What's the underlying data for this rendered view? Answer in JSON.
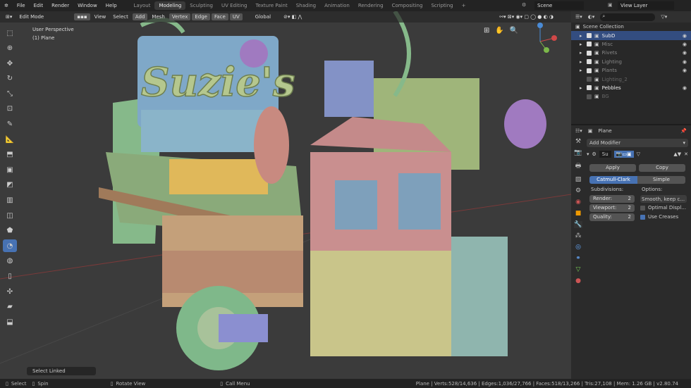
{
  "menu": [
    "File",
    "Edit",
    "Render",
    "Window",
    "Help"
  ],
  "workspaces": [
    {
      "label": "Layout"
    },
    {
      "label": "Modeling",
      "active": true
    },
    {
      "label": "Sculpting"
    },
    {
      "label": "UV Editing"
    },
    {
      "label": "Texture Paint"
    },
    {
      "label": "Shading"
    },
    {
      "label": "Animation"
    },
    {
      "label": "Rendering"
    },
    {
      "label": "Compositing"
    },
    {
      "label": "Scripting"
    },
    {
      "label": "+"
    }
  ],
  "scene": "Scene",
  "view_layer": "View Layer",
  "header": {
    "mode": "Edit Mode",
    "menus": [
      "View",
      "Select",
      "Add",
      "Mesh",
      "Vertex",
      "Edge",
      "Face",
      "UV"
    ],
    "orientation": "Global"
  },
  "viewport": {
    "view_name": "User Perspective",
    "object": "(1) Plane",
    "sign_text": "Suzie's",
    "last_op": "Select Linked"
  },
  "outliner": {
    "root": "Scene Collection",
    "items": [
      {
        "name": "SubD",
        "checked": true,
        "selected": true
      },
      {
        "name": "Misc",
        "checked": true
      },
      {
        "name": "Rivets",
        "checked": true
      },
      {
        "name": "Lighting",
        "checked": true
      },
      {
        "name": "Plants",
        "checked": true
      },
      {
        "name": "Lighting_2",
        "checked": false
      },
      {
        "name": "Pebbles",
        "checked": true
      },
      {
        "name": "BG",
        "checked": false
      }
    ]
  },
  "properties": {
    "object": "Plane",
    "add_modifier": "Add Modifier",
    "modifier_name": "Su",
    "apply": "Apply",
    "copy": "Copy",
    "catmull": "Catmull-Clark",
    "simple": "Simple",
    "subdivisions": "Subdivisions:",
    "options": "Options:",
    "render_label": "Render:",
    "render_val": "2",
    "viewport_label": "Viewport:",
    "viewport_val": "2",
    "quality_label": "Quality:",
    "quality_val": "2",
    "uv_smooth": "Smooth, keep c...",
    "optimal": "Optimal Displ...",
    "optimal_checked": false,
    "creases": "Use Creases",
    "creases_checked": true
  },
  "status": {
    "select": "Select",
    "spin": "Spin",
    "rotate": "Rotate View",
    "call_menu": "Call Menu",
    "stats": "Plane | Verts:528/14,636 | Edges:1,036/27,766 | Faces:518/13,266 | Tris:27,108 | Mem: 1.26 GB | v2.80.74"
  },
  "colors": {
    "accent": "#4772b3",
    "selection": "#334d80"
  }
}
